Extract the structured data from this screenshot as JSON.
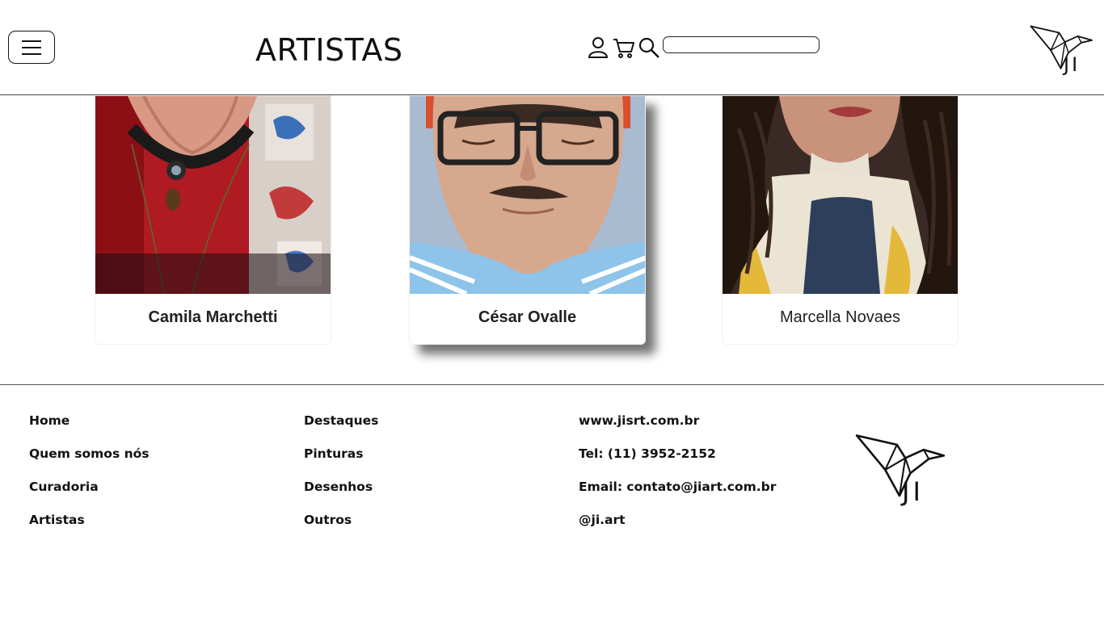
{
  "header": {
    "title": "ARTISTAS",
    "search": {
      "value": "",
      "placeholder": ""
    },
    "logo_text": "JI"
  },
  "artists": [
    {
      "name": "Camila Marchetti"
    },
    {
      "name": "César Ovalle"
    },
    {
      "name": "Marcella Novaes"
    }
  ],
  "footer": {
    "nav": [
      "Home",
      "Quem somos nós",
      "Curadoria",
      "Artistas"
    ],
    "categories": [
      "Destaques",
      "Pinturas",
      "Desenhos",
      "Outros"
    ],
    "contact": {
      "site": "www.jisrt.com.br",
      "phone": "Tel: (11) 3952-2152",
      "email": "Email: contato@jiart.com.br",
      "social": "@ji.art"
    },
    "logo_text": "JI"
  },
  "colors": {
    "text": "#111111",
    "border": "#444444",
    "background": "#ffffff"
  }
}
